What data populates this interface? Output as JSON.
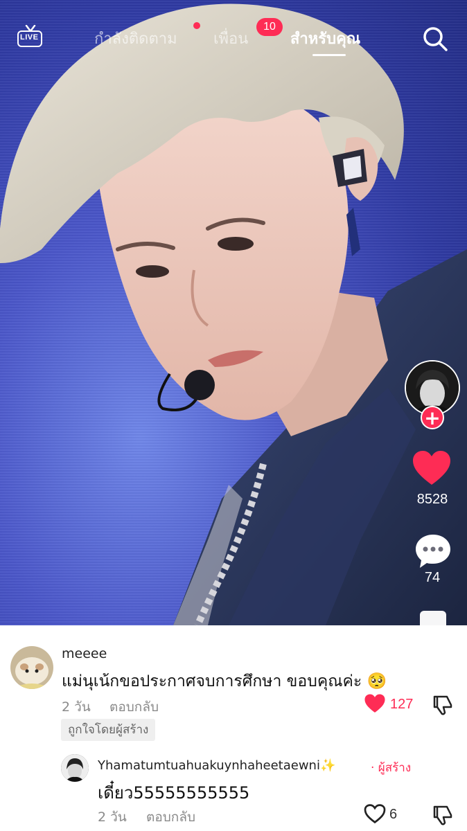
{
  "top_nav": {
    "live_label": "LIVE",
    "tabs": [
      {
        "label": "กำลังติดตาม"
      },
      {
        "label": "เพื่อน"
      },
      {
        "label": "สำหรับคุณ"
      }
    ],
    "friends_badge": "10",
    "active_tab": "สำหรับคุณ"
  },
  "action_rail": {
    "likes": "8528",
    "comments": "74"
  },
  "comments": [
    {
      "username": "meeee",
      "text": "แม่นุเน้กขอประกาศจบการศึกษา ขอบคุณค่ะ 🥺",
      "time": "2 วัน",
      "reply_label": "ตอบกลับ",
      "likes": "127",
      "liked_by_creator_label": "ถูกใจโดยผู้สร้าง"
    },
    {
      "username": "Yhamatumtuahuakuynhaheetaewni✨",
      "creator_label": "· ผู้สร้าง",
      "text": "เดี๋ยว55555555555",
      "time": "2 วัน",
      "reply_label": "ตอบกลับ",
      "likes": "6"
    }
  ],
  "colors": {
    "accent": "#fe2c55",
    "video_bg": "#3a46b8",
    "muted_text": "#8a8a8a"
  }
}
